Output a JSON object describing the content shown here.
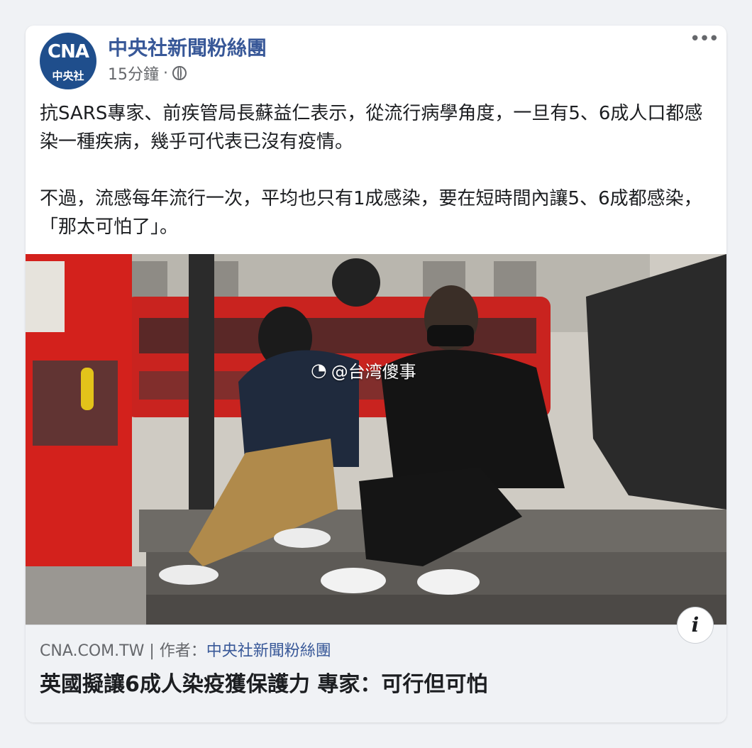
{
  "post": {
    "page_name": "中央社新聞粉絲團",
    "avatar_text": "CNA",
    "avatar_sub": "中央社",
    "timestamp": "15分鐘",
    "dot": "·",
    "more_label": "•••",
    "paragraphs": [
      "抗SARS專家、前疾管局長蘇益仁表示，從流行病學角度，一旦有5、6成人口都感染一種疾病，幾乎可代表已沒有疫情。",
      "不過，流感每年流行一次，平均也只有1成感染，要在短時間內讓5、6成都感染，「那太可怕了」。"
    ]
  },
  "photo": {
    "watermark": "@台湾傻事"
  },
  "link": {
    "domain": "CNA.COM.TW",
    "separator": "|",
    "author_label": "作者：",
    "author_name": "中央社新聞粉絲團",
    "title": "英國擬讓6成人染疫獲保護力 專家：可行但可怕",
    "info_icon": "i"
  }
}
